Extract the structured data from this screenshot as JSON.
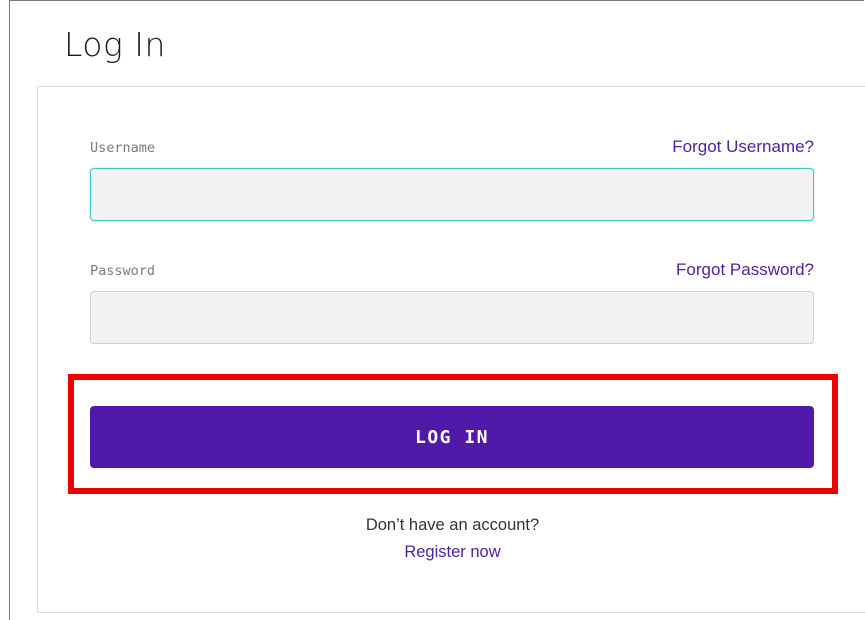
{
  "page": {
    "title": "Log In"
  },
  "form": {
    "username": {
      "label": "Username",
      "value": "",
      "forgot_link": "Forgot Username?"
    },
    "password": {
      "label": "Password",
      "value": "",
      "forgot_link": "Forgot Password?"
    },
    "submit_label": "LOG IN"
  },
  "footer": {
    "no_account_text": "Don’t have an account?",
    "register_link": "Register now"
  },
  "colors": {
    "accent": "#5019a8",
    "link": "#4f1fa0",
    "focus_border": "#3cc6c9",
    "highlight": "#ee0000"
  }
}
